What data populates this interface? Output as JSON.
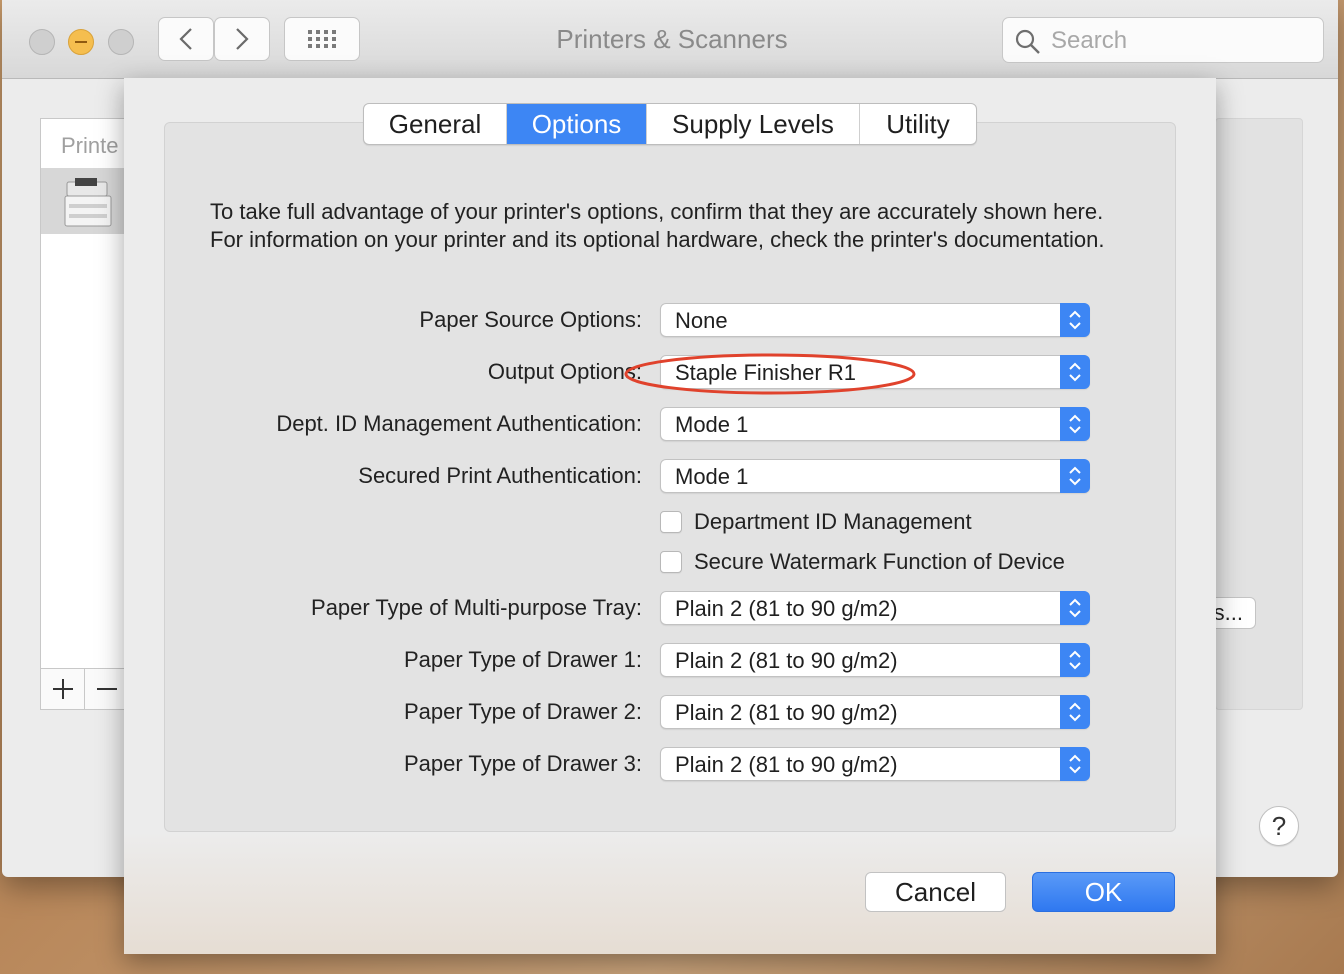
{
  "window": {
    "title": "Printers & Scanners",
    "search_placeholder": "Search"
  },
  "background": {
    "printers_header": "Printe",
    "options_button_partial": "s...",
    "help_label": "?"
  },
  "sheet": {
    "tabs": [
      {
        "label": "General",
        "active": false
      },
      {
        "label": "Options",
        "active": true
      },
      {
        "label": "Supply Levels",
        "active": false
      },
      {
        "label": "Utility",
        "active": false
      }
    ],
    "intro": "To take full advantage of your printer's options, confirm that they are accurately shown here. For information on your printer and its optional hardware, check the printer's documentation.",
    "fields": {
      "paper_source": {
        "label": "Paper Source Options:",
        "value": "None"
      },
      "output": {
        "label": "Output Options:",
        "value": "Staple Finisher R1"
      },
      "dept_id_auth": {
        "label": "Dept. ID Management Authentication:",
        "value": "Mode 1"
      },
      "secured_print_auth": {
        "label": "Secured Print Authentication:",
        "value": "Mode 1"
      },
      "mp_tray": {
        "label": "Paper Type of Multi-purpose Tray:",
        "value": "Plain 2 (81 to 90 g/m2)"
      },
      "drawer1": {
        "label": "Paper Type of Drawer 1:",
        "value": "Plain 2 (81 to 90 g/m2)"
      },
      "drawer2": {
        "label": "Paper Type of Drawer 2:",
        "value": "Plain 2 (81 to 90 g/m2)"
      },
      "drawer3": {
        "label": "Paper Type of Drawer 3:",
        "value": "Plain 2 (81 to 90 g/m2)"
      }
    },
    "checkboxes": {
      "dept_id": {
        "label": "Department ID Management",
        "checked": false
      },
      "watermark": {
        "label": "Secure Watermark Function of Device",
        "checked": false
      }
    },
    "buttons": {
      "cancel": "Cancel",
      "ok": "OK"
    }
  },
  "colors": {
    "accent": "#3d86f4",
    "annotation": "#e0422c"
  }
}
